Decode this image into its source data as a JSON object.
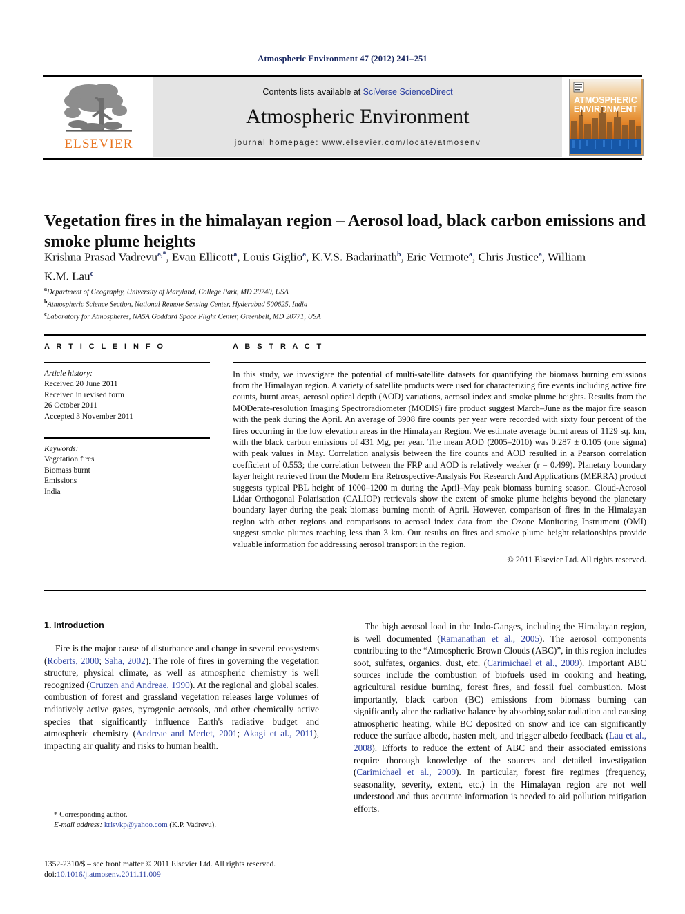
{
  "running_head": "Atmospheric Environment 47 (2012) 241–251",
  "masthead": {
    "contents_prefix": "Contents lists available at ",
    "sciencedirect": "SciVerse ScienceDirect",
    "journal_title": "Atmospheric Environment",
    "homepage": "journal homepage: www.elsevier.com/locate/atmosenv",
    "publisher_name": "ELSEVIER",
    "publisher_color": "#e8731e",
    "link_color": "#2b3fa0",
    "panel_color": "#e4e4e4",
    "cover": {
      "line1": "ATMOSPHERIC",
      "line2": "ENVIRONMENT",
      "sky_color": "#e8861f",
      "water_color": "#1657a8"
    }
  },
  "title": "Vegetation fires in the himalayan region – Aerosol load, black carbon emissions and smoke plume heights",
  "authors": [
    {
      "name": "Krishna Prasad Vadrevu",
      "sup": "a,*"
    },
    {
      "name": "Evan Ellicott",
      "sup": "a"
    },
    {
      "name": "Louis Giglio",
      "sup": "a"
    },
    {
      "name": "K.V.S. Badarinath",
      "sup": "b"
    },
    {
      "name": "Eric Vermote",
      "sup": "a"
    },
    {
      "name": "Chris Justice",
      "sup": "a"
    },
    {
      "name": "William K.M. Lau",
      "sup": "c"
    }
  ],
  "affiliations": [
    {
      "marker": "a",
      "text": "Department of Geography, University of Maryland, College Park, MD 20740, USA"
    },
    {
      "marker": "b",
      "text": "Atmospheric Science Section, National Remote Sensing Center, Hyderabad 500625, India"
    },
    {
      "marker": "c",
      "text": "Laboratory for Atmospheres, NASA Goddard Space Flight Center, Greenbelt, MD 20771, USA"
    }
  ],
  "article_info": {
    "heading": "A R T I C L E  I N F O",
    "history_label": "Article history:",
    "history": [
      "Received 20 June 2011",
      "Received in revised form",
      "26 October 2011",
      "Accepted 3 November 2011"
    ],
    "keywords_label": "Keywords:",
    "keywords": [
      "Vegetation fires",
      "Biomass burnt",
      "Emissions",
      "India"
    ]
  },
  "abstract": {
    "heading": "A B S T R A C T",
    "text": "In this study, we investigate the potential of multi-satellite datasets for quantifying the biomass burning emissions from the Himalayan region. A variety of satellite products were used for characterizing fire events including active fire counts, burnt areas, aerosol optical depth (AOD) variations, aerosol index and smoke plume heights. Results from the MODerate-resolution Imaging Spectroradiometer (MODIS) fire product suggest March–June as the major fire season with the peak during the April. An average of 3908 fire counts per year were recorded with sixty four percent of the fires occurring in the low elevation areas in the Himalayan Region. We estimate average burnt areas of 1129 sq. km, with the black carbon emissions of 431 Mg, per year. The mean AOD (2005–2010) was 0.287 ± 0.105 (one sigma) with peak values in May. Correlation analysis between the fire counts and AOD resulted in a Pearson correlation coefficient of 0.553; the correlation between the FRP and AOD is relatively weaker (r = 0.499). Planetary boundary layer height retrieved from the Modern Era Retrospective-Analysis For Research And Applications (MERRA) product suggests typical PBL height of 1000–1200 m during the April–May peak biomass burning season. Cloud-Aerosol Lidar Orthogonal Polarisation (CALIOP) retrievals show the extent of smoke plume heights beyond the planetary boundary layer during the peak biomass burning month of April. However, comparison of fires in the Himalayan region with other regions and comparisons to aerosol index data from the Ozone Monitoring Instrument (OMI) suggest smoke plumes reaching less than 3 km. Our results on fires and smoke plume height relationships provide valuable information for addressing aerosol transport in the region.",
    "copyright": "© 2011 Elsevier Ltd. All rights reserved."
  },
  "body": {
    "section_heading": "1. Introduction",
    "left_paragraphs": [
      {
        "runs": [
          {
            "t": "Fire is the major cause of disturbance and change in several ecosystems ("
          },
          {
            "t": "Roberts, 2000",
            "cite": true
          },
          {
            "t": "; "
          },
          {
            "t": "Saha, 2002",
            "cite": true
          },
          {
            "t": "). The role of fires in governing the vegetation structure, physical climate, as well as atmospheric chemistry is well recognized ("
          },
          {
            "t": "Crutzen and Andreae, 1990",
            "cite": true
          },
          {
            "t": "). At the regional and global scales, combustion of forest and grassland vegetation releases large volumes of radiatively active gases, pyrogenic aerosols, and other chemically active species that significantly influence Earth's radiative budget and atmospheric chemistry ("
          },
          {
            "t": "Andreae and Merlet, 2001",
            "cite": true
          },
          {
            "t": "; "
          },
          {
            "t": "Akagi et al., 2011",
            "cite": true
          },
          {
            "t": "), impacting air quality and risks to human health."
          }
        ]
      }
    ],
    "right_paragraphs": [
      {
        "runs": [
          {
            "t": "The high aerosol load in the Indo-Ganges, including the Himalayan region, is well documented ("
          },
          {
            "t": "Ramanathan et al., 2005",
            "cite": true
          },
          {
            "t": "). The aerosol components contributing to the “Atmospheric Brown Clouds (ABC)”, in this region includes soot, sulfates, organics, dust, etc. ("
          },
          {
            "t": "Carimichael et al., 2009",
            "cite": true
          },
          {
            "t": "). Important ABC sources include the combustion of biofuels used in cooking and heating, agricultural residue burning, forest fires, and fossil fuel combustion. Most importantly, black carbon (BC) emissions from biomass burning can significantly alter the radiative balance by absorbing solar radiation and causing atmospheric heating, while BC deposited on snow and ice can significantly reduce the surface albedo, hasten melt, and trigger albedo feedback ("
          },
          {
            "t": "Lau et al., 2008",
            "cite": true
          },
          {
            "t": "). Efforts to reduce the extent of ABC and their associated emissions require thorough knowledge of the sources and detailed investigation ("
          },
          {
            "t": "Carimichael et al., 2009",
            "cite": true
          },
          {
            "t": "). In particular, forest fire regimes (frequency, seasonality, severity, extent, etc.) in the Himalayan region are not well understood and thus accurate information is needed to aid pollution mitigation efforts."
          }
        ]
      }
    ]
  },
  "footnotes": {
    "corresponding": "* Corresponding author.",
    "email_label": "E-mail address:",
    "email": "krisvkp@yahoo.com",
    "email_suffix": "(K.P. Vadrevu)."
  },
  "imprint": {
    "front_matter": "1352-2310/$ – see front matter © 2011 Elsevier Ltd. All rights reserved.",
    "doi_label": "doi:",
    "doi": "10.1016/j.atmosenv.2011.11.009"
  }
}
